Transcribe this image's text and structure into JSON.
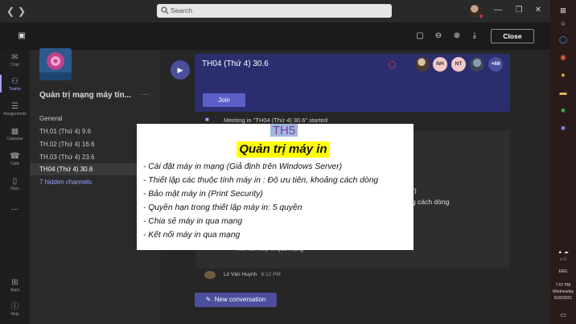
{
  "titlebar": {
    "back_icon": "chevron-left-icon",
    "forward_icon": "chevron-right-icon",
    "search_placeholder": "Search"
  },
  "toolbar": {
    "close_label": "Close"
  },
  "rail": {
    "items": [
      {
        "label": "Chat",
        "icon": "chat-icon"
      },
      {
        "label": "Teams",
        "icon": "teams-icon"
      },
      {
        "label": "Assignments",
        "icon": "assignments-icon"
      },
      {
        "label": "Calendar",
        "icon": "calendar-icon"
      },
      {
        "label": "Calls",
        "icon": "phone-icon"
      },
      {
        "label": "Files",
        "icon": "files-icon"
      },
      {
        "label": "Apps",
        "icon": "apps-icon"
      },
      {
        "label": "Help",
        "icon": "help-icon"
      }
    ],
    "more": "..."
  },
  "team": {
    "name": "Quản trị mạng máy tín...",
    "more": "···",
    "channels": [
      "General",
      "TH.01 (Thứ 4) 9.6",
      "TH.02 (Thứ 4) 16.6",
      "TH.03 (Thứ 4) 23.6",
      "TH04 (Thứ 4) 30.6"
    ],
    "hidden_channels": "7 hidden channels"
  },
  "meeting": {
    "title": "TH04 (Thứ 4) 30.6",
    "participants": [
      "NH",
      "NT"
    ],
    "extra_count": "+69",
    "join_label": "Join",
    "started_text": "Meeting in \"TH04 (Thứ 4) 30.6\" started",
    "author": "Lò Văn Huynh",
    "time": "6:12 PM",
    "frag_1": "r)",
    "frag_2": "g cách dòng",
    "frag_3": "~Kết nối máy in qua mạng",
    "new_conversation": "New conversation"
  },
  "slide": {
    "tag": "TH5",
    "title": "Quản trị máy in",
    "lines": [
      "- Cài đặt máy in mạng (Giả định trên Windows Server)",
      "- Thiết lập các thuộc tính máy in : Độ ưu tiên, khoảng cách dòng",
      "- Bảo mật máy in (Print Security)",
      "- Quyền hạn trong thiết lập máy in: 5 quyền",
      "- Chia sẻ máy in qua mạng",
      "- Kết nối máy in qua mạng"
    ]
  },
  "taskbar": {
    "lang": "ENG",
    "time": "7:07 PM",
    "day": "Wednesday",
    "date": "6/30/2021"
  },
  "colors": {
    "accent": "#5b5fc7",
    "meeting_card": "#2b2e6e",
    "highlight": "#ffff00"
  }
}
